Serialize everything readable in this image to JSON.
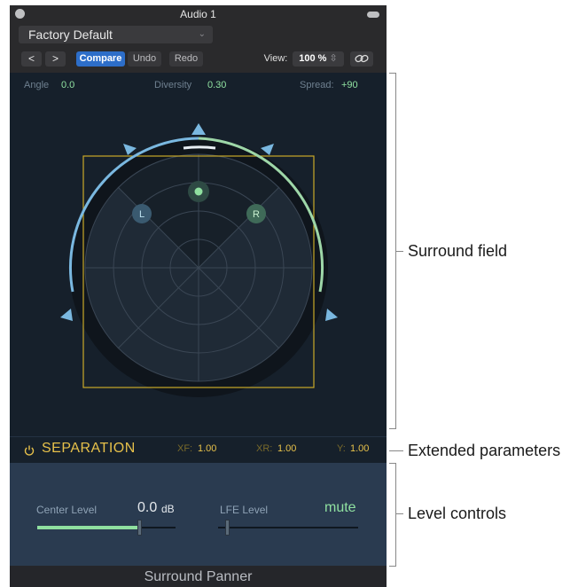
{
  "window": {
    "title": "Audio 1"
  },
  "preset": {
    "name": "Factory Default"
  },
  "toolbar": {
    "prev": "<",
    "next": ">",
    "compare": "Compare",
    "undo": "Undo",
    "redo": "Redo",
    "view_label": "View:",
    "zoom": "100 %"
  },
  "params": {
    "angle_label": "Angle",
    "angle_value": "0.0",
    "diversity_label": "Diversity",
    "diversity_value": "0.30",
    "spread_label": "Spread:",
    "spread_value": "+90"
  },
  "field": {
    "left_label": "L",
    "right_label": "R"
  },
  "separation": {
    "title": "SEPARATION",
    "xf_label": "XF:",
    "xf_value": "1.00",
    "xr_label": "XR:",
    "xr_value": "1.00",
    "y_label": "Y:",
    "y_value": "1.00"
  },
  "levels": {
    "center_label": "Center Level",
    "center_value": "0.0",
    "center_unit": "dB",
    "center_fraction": 0.74,
    "lfe_label": "LFE Level",
    "lfe_value": "mute",
    "lfe_fraction": 0.0
  },
  "footer": {
    "title": "Surround Panner"
  },
  "callouts": {
    "surround_field": "Surround field",
    "extended_parameters": "Extended parameters",
    "level_controls": "Level controls"
  },
  "colors": {
    "accent_green": "#8fe0a0",
    "accent_yellow": "#e6c04a",
    "speaker_blue": "#7ab8e0",
    "compare_blue": "#2d6ec9"
  }
}
